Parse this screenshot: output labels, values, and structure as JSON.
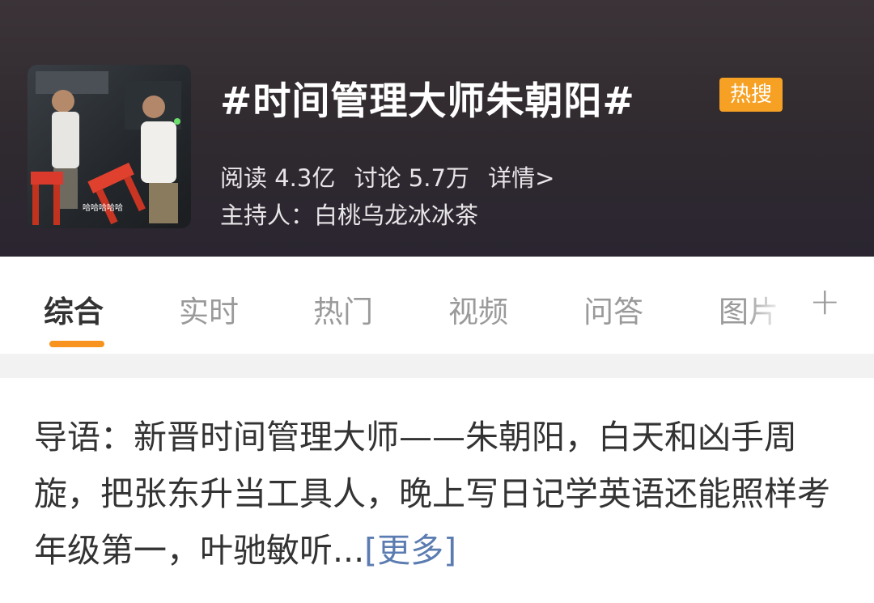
{
  "topic": {
    "title": "#时间管理大师朱朝阳#",
    "badge": "热搜",
    "stats": {
      "reads": "阅读 4.3亿",
      "discuss": "讨论 5.7万",
      "details": "详情>"
    },
    "host": "主持人：白桃乌龙冰冰茶",
    "thumbnail_caption": "哈哈哈哈哈"
  },
  "tabs": [
    {
      "label": "综合",
      "active": true
    },
    {
      "label": "实时",
      "active": false
    },
    {
      "label": "热门",
      "active": false
    },
    {
      "label": "视频",
      "active": false
    },
    {
      "label": "问答",
      "active": false
    },
    {
      "label": "图片",
      "active": false
    }
  ],
  "tabs_plus": "+",
  "intro": {
    "text": "导语：新晋时间管理大师——朱朝阳，白天和凶手周旋，把张东升当工具人，晚上写日记学英语还能照样考年级第一，叶驰敏听...",
    "more": "[更多]"
  },
  "colors": {
    "header_bg": "#2f2a2f",
    "badge": "#f7a124",
    "tab_underline": "#f7931e",
    "more_link": "#5b7cb0"
  }
}
